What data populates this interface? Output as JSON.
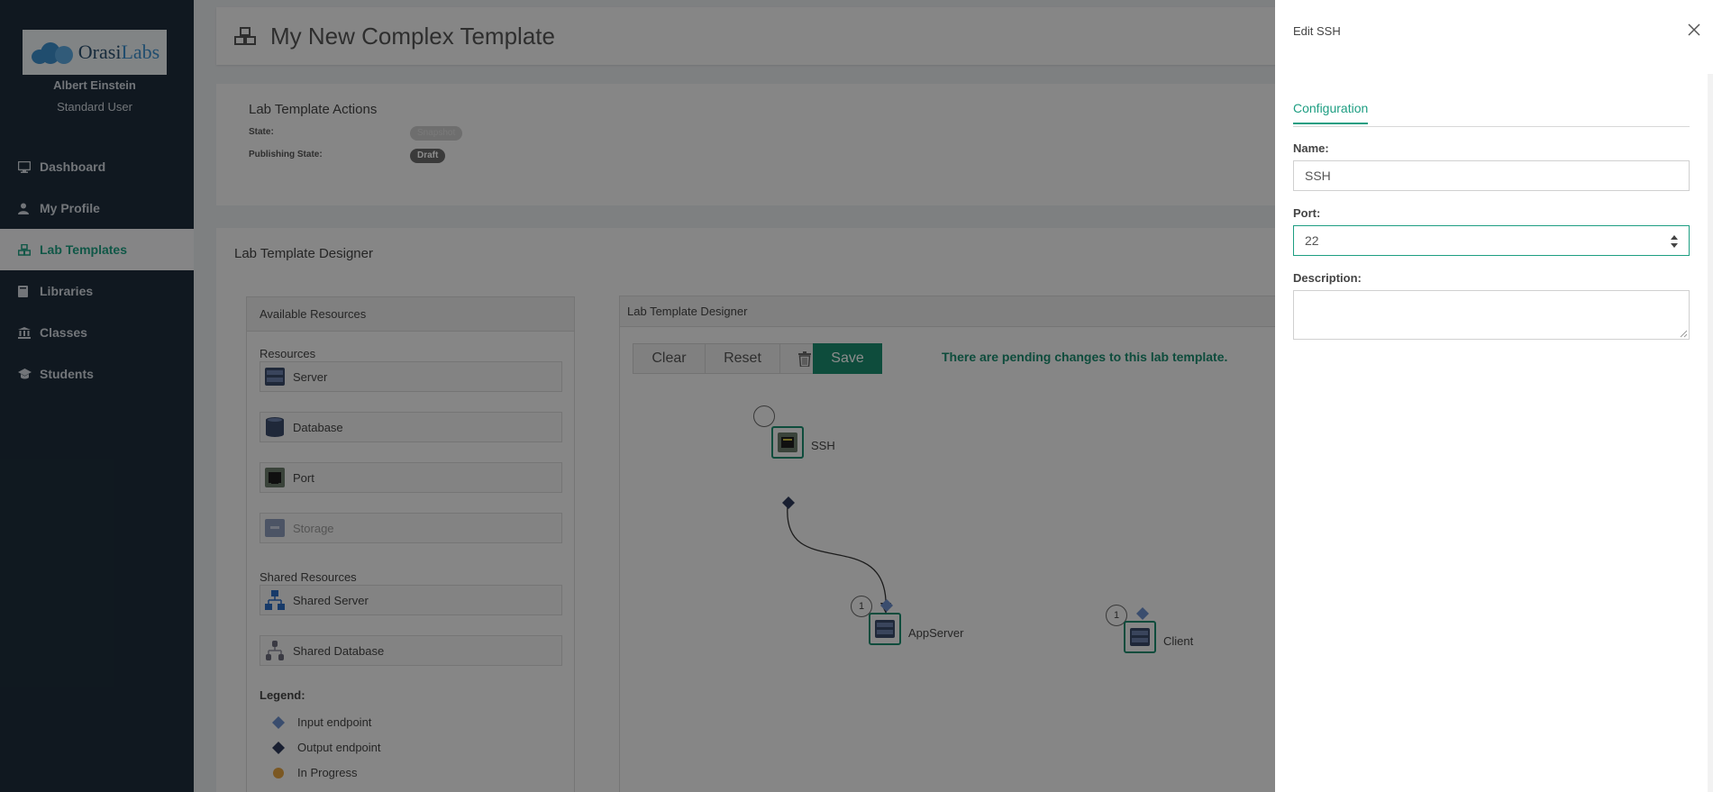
{
  "sidebar": {
    "logo_prefix": "Orasi",
    "logo_suffix": "Labs",
    "user_name": "Albert Einstein",
    "user_role": "Standard User",
    "items": [
      {
        "label": "Dashboard",
        "icon": "monitor-icon"
      },
      {
        "label": "My Profile",
        "icon": "user-icon"
      },
      {
        "label": "Lab Templates",
        "icon": "cubes-icon",
        "active": true
      },
      {
        "label": "Libraries",
        "icon": "book-icon"
      },
      {
        "label": "Classes",
        "icon": "institution-icon"
      },
      {
        "label": "Students",
        "icon": "graduation-cap-icon"
      }
    ]
  },
  "header": {
    "title": "My New Complex Template",
    "icon": "cubes-icon"
  },
  "actions": {
    "title": "Lab Template Actions",
    "state_label": "State:",
    "state_value": "Snapshot",
    "publishing_label": "Publishing State:",
    "publishing_value": "Draft"
  },
  "designer": {
    "title": "Lab Template Designer",
    "available": {
      "title": "Available Resources",
      "resources_label": "Resources",
      "resources": [
        "Server",
        "Database",
        "Port",
        "Storage"
      ],
      "shared_label": "Shared Resources",
      "shared": [
        "Shared Server",
        "Shared Database"
      ],
      "legend_title": "Legend:",
      "legend": [
        "Input endpoint",
        "Output endpoint",
        "In Progress"
      ]
    },
    "canvas": {
      "title": "Lab Template Designer",
      "clear": "Clear",
      "reset": "Reset",
      "save": "Save",
      "pending": "There are pending changes to this lab template.",
      "nodes": [
        {
          "label": "SSH"
        },
        {
          "label": "AppServer",
          "count": "1"
        },
        {
          "label": "Client",
          "count": "1"
        }
      ]
    }
  },
  "panel": {
    "title": "Edit SSH",
    "tab": "Configuration",
    "name_label": "Name:",
    "name_value": "SSH",
    "port_label": "Port:",
    "port_value": "22",
    "description_label": "Description:",
    "description_value": ""
  },
  "colors": {
    "accent": "#1e9e82",
    "sidebar": "#1e2d3b",
    "save": "#1a8a6e"
  }
}
